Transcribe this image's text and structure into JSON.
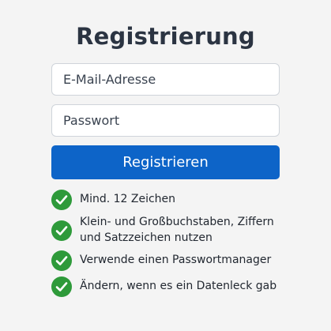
{
  "form": {
    "title": "Registrierung",
    "email_placeholder": "E-Mail-Adresse",
    "password_placeholder": "Passwort",
    "submit_label": "Registrieren"
  },
  "tips": {
    "icon": "check-circle-icon",
    "items": [
      {
        "line1": "Mind. 12 Zeichen",
        "line2": ""
      },
      {
        "line1": "Klein- und Großbuchstaben, Ziffern",
        "line2": "und Satzzeichen nutzen"
      },
      {
        "line1": "Verwende einen Passwortmanager",
        "line2": ""
      },
      {
        "line1": "Ändern, wenn es ein Datenleck gab",
        "line2": ""
      }
    ]
  },
  "colors": {
    "primary_button": "#0d64c8",
    "check_green": "#2e9a3a",
    "title_text": "#2b3442",
    "background": "#f4f4f4"
  }
}
